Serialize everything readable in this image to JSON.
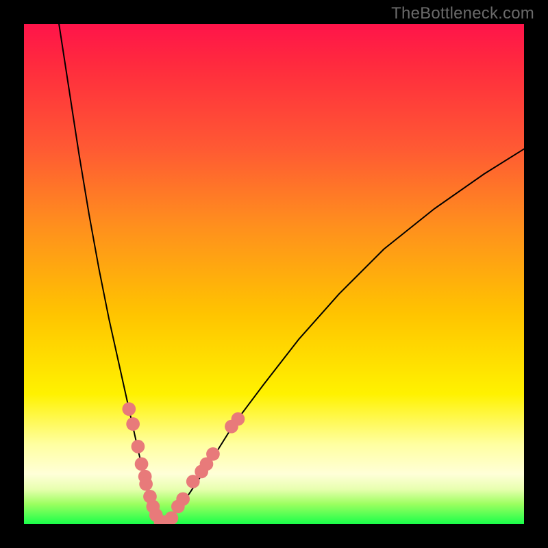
{
  "watermark": "TheBottleneck.com",
  "colors": {
    "frame": "#000000",
    "curve_stroke": "#000000",
    "marker_fill": "#e87a7a",
    "gradient_stops": [
      "#ff144a",
      "#ff2a3e",
      "#ff5a33",
      "#ff8e1e",
      "#ffc400",
      "#fff200",
      "#ffffa0",
      "#ffffd8",
      "#e8ffb0",
      "#9cff60",
      "#1aff4a"
    ]
  },
  "chart_data": {
    "type": "line",
    "title": "",
    "xlabel": "",
    "ylabel": "",
    "xlim": [
      0,
      100
    ],
    "ylim": [
      0,
      100
    ],
    "description": "V-shaped bottleneck curve: two branches descending from top-left and top-right, meeting near zero around x≈27. Background gradient encodes bottleneck severity (red=high, green=none). Salmon dots mark sample configurations clustered near the minimum.",
    "series": [
      {
        "name": "left-branch",
        "x": [
          7,
          9,
          11,
          13,
          15,
          17,
          19,
          21,
          23,
          24,
          25,
          26,
          27,
          28
        ],
        "values": [
          100,
          87,
          74,
          62,
          51,
          41,
          32,
          23,
          14,
          10,
          6,
          3,
          1,
          0
        ]
      },
      {
        "name": "right-branch",
        "x": [
          28,
          30,
          33,
          37,
          42,
          48,
          55,
          63,
          72,
          82,
          92,
          100
        ],
        "values": [
          0,
          2,
          6,
          12,
          20,
          28,
          37,
          46,
          55,
          63,
          70,
          75
        ]
      }
    ],
    "markers": [
      {
        "x": 21.0,
        "y": 23.0
      },
      {
        "x": 21.8,
        "y": 20.0
      },
      {
        "x": 22.8,
        "y": 15.5
      },
      {
        "x": 23.5,
        "y": 12.0
      },
      {
        "x": 24.2,
        "y": 9.5
      },
      {
        "x": 24.4,
        "y": 8.0
      },
      {
        "x": 25.2,
        "y": 5.5
      },
      {
        "x": 25.8,
        "y": 3.5
      },
      {
        "x": 26.4,
        "y": 1.8
      },
      {
        "x": 27.3,
        "y": 0.5
      },
      {
        "x": 28.3,
        "y": 0.4
      },
      {
        "x": 29.5,
        "y": 1.2
      },
      {
        "x": 30.8,
        "y": 3.5
      },
      {
        "x": 31.8,
        "y": 5.0
      },
      {
        "x": 33.8,
        "y": 8.5
      },
      {
        "x": 35.5,
        "y": 10.5
      },
      {
        "x": 36.5,
        "y": 12.0
      },
      {
        "x": 37.8,
        "y": 14.0
      },
      {
        "x": 41.5,
        "y": 19.5
      },
      {
        "x": 42.8,
        "y": 21.0
      }
    ]
  }
}
